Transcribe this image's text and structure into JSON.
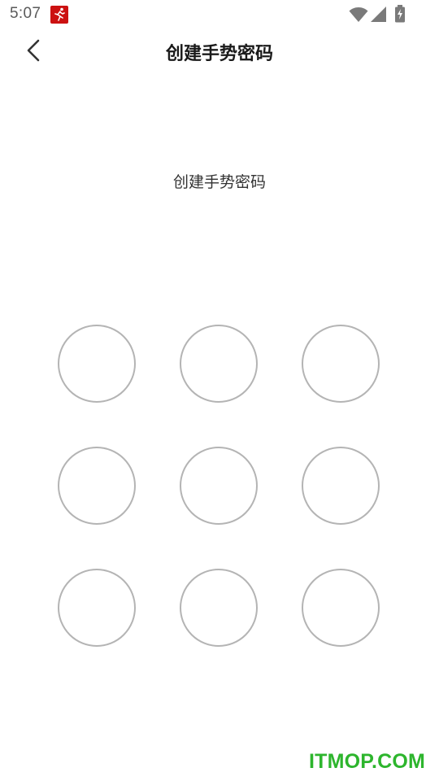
{
  "status_bar": {
    "time": "5:07",
    "notification_icon": "running-man-icon",
    "wifi_icon": "wifi-icon",
    "signal_icon": "cellular-signal-icon",
    "battery_icon": "battery-charging-icon",
    "notification_color": "#cc1111"
  },
  "header": {
    "back_icon": "chevron-left-icon",
    "title": "创建手势密码"
  },
  "prompt": {
    "text": "创建手势密码"
  },
  "gesture_pad": {
    "rows": 3,
    "columns": 3,
    "dot_border_color": "#b4b4b4"
  },
  "watermark": {
    "text": "ITMOP.COM",
    "color": "#2db52d"
  }
}
